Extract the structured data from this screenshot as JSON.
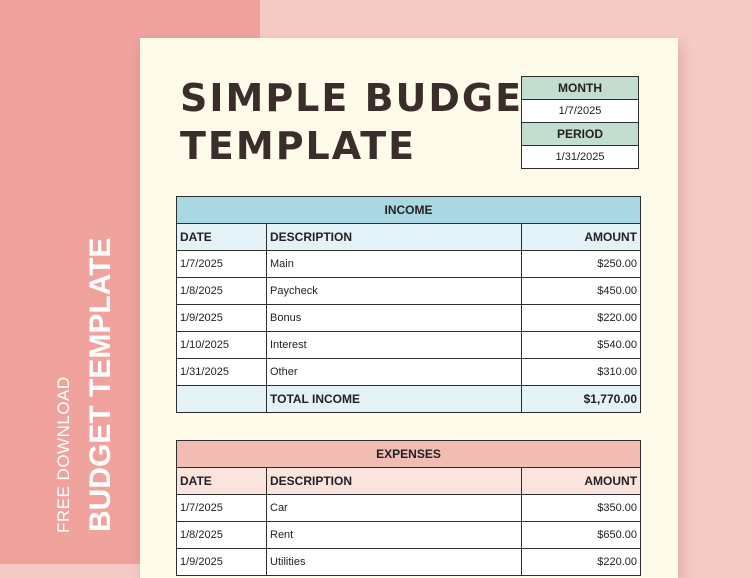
{
  "side": {
    "small": "FREE DOWNLOAD",
    "big": "BUDGET TEMPLATE"
  },
  "title": {
    "line1": "SIMPLE BUDGET",
    "line2": "TEMPLATE"
  },
  "meta": {
    "month_label": "MONTH",
    "month_value": "1/7/2025",
    "period_label": "PERIOD",
    "period_value": "1/31/2025"
  },
  "income": {
    "caption": "INCOME",
    "columns": [
      "DATE",
      "DESCRIPTION",
      "AMOUNT"
    ],
    "rows": [
      {
        "date": "1/7/2025",
        "description": "Main",
        "amount": "$250.00"
      },
      {
        "date": "1/8/2025",
        "description": "Paycheck",
        "amount": "$450.00"
      },
      {
        "date": "1/9/2025",
        "description": "Bonus",
        "amount": "$220.00"
      },
      {
        "date": "1/10/2025",
        "description": "Interest",
        "amount": "$540.00"
      },
      {
        "date": "1/31/2025",
        "description": "Other",
        "amount": "$310.00"
      }
    ],
    "total_label": "TOTAL INCOME",
    "total_value": "$1,770.00"
  },
  "expenses": {
    "caption": "EXPENSES",
    "columns": [
      "DATE",
      "DESCRIPTION",
      "AMOUNT"
    ],
    "rows": [
      {
        "date": "1/7/2025",
        "description": "Car",
        "amount": "$350.00"
      },
      {
        "date": "1/8/2025",
        "description": "Rent",
        "amount": "$650.00"
      },
      {
        "date": "1/9/2025",
        "description": "Utilities",
        "amount": "$220.00"
      }
    ]
  },
  "colors": {
    "left_band": "#efa39c",
    "background": "#f6cbc6",
    "paper": "#fefbeb",
    "income_header": "#a9d8e2",
    "expenses_header": "#f1bcb2",
    "meta_header": "#c3ddce"
  }
}
